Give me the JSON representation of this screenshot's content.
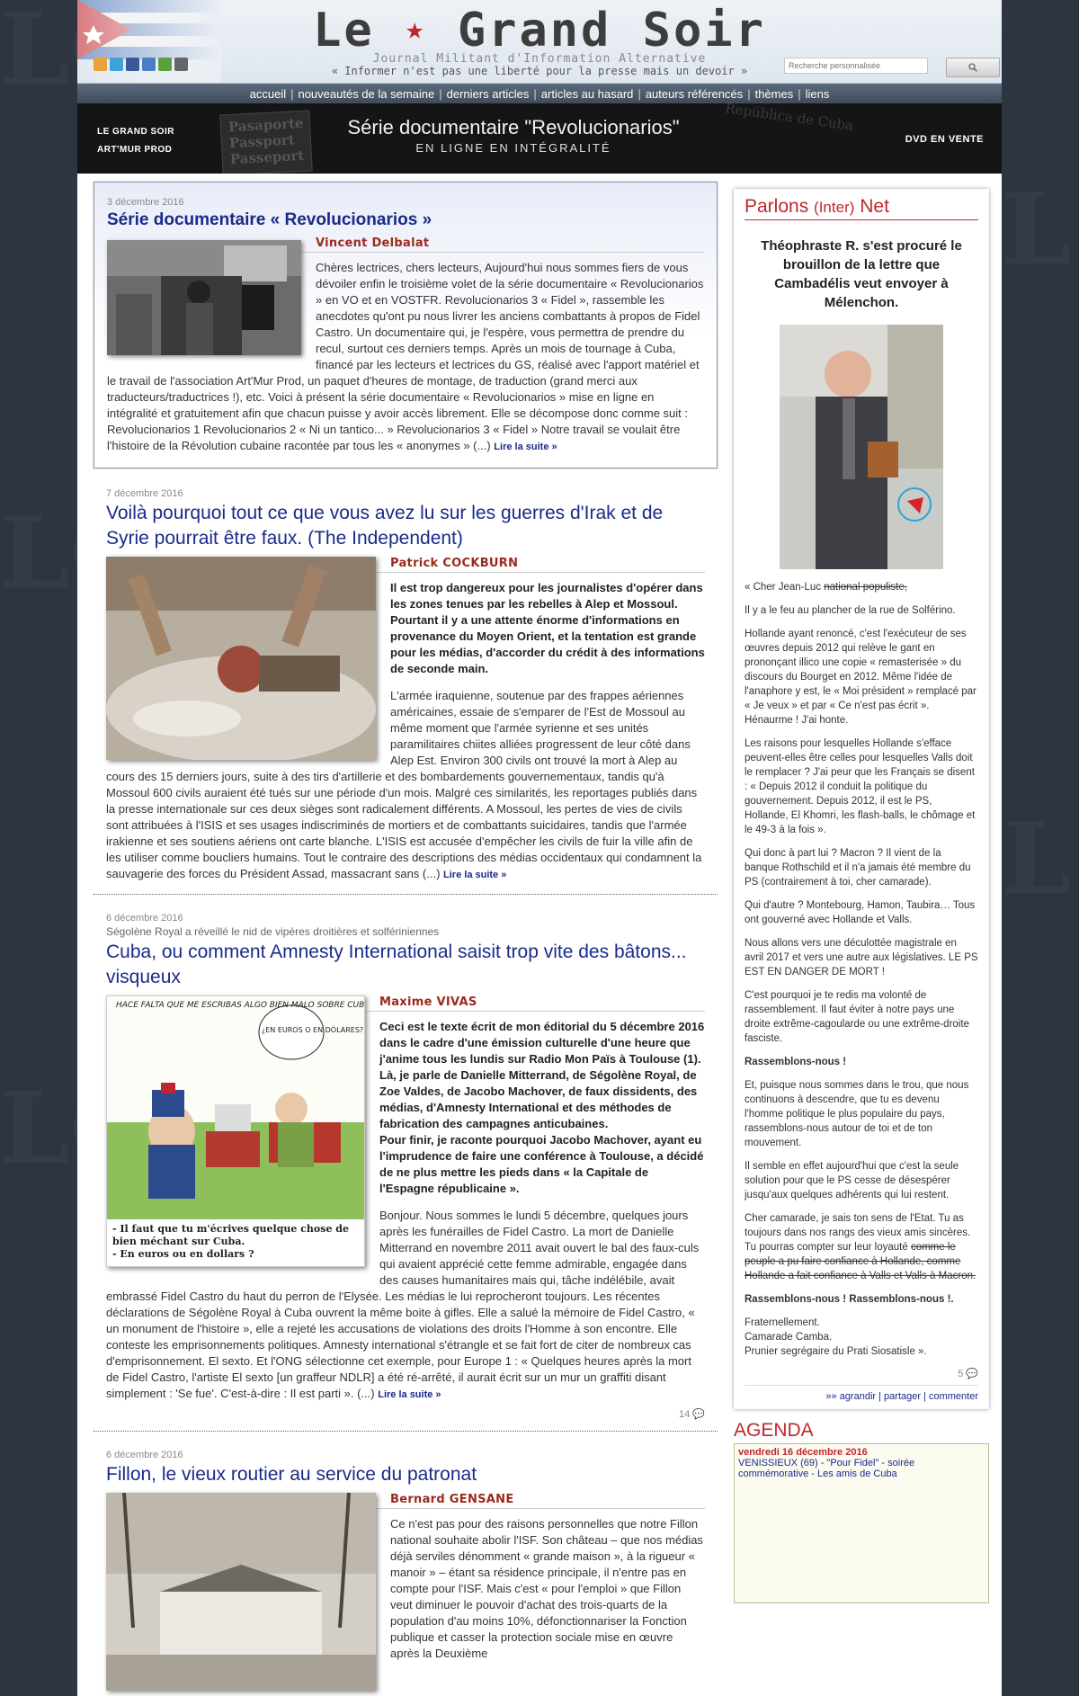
{
  "header": {
    "logo_left": "Le",
    "logo_right": "Grand Soir",
    "tagline": "Journal Militant d'Information Alternative",
    "motto": "« Informer n'est pas une liberté pour la presse mais un devoir »",
    "search_placeholder": "Recherche personnalisée"
  },
  "nav": {
    "items": [
      "accueil",
      "nouveautés de la semaine",
      "derniers articles",
      "articles au hasard",
      "auteurs référencés",
      "thèmes",
      "liens"
    ]
  },
  "banner": {
    "left_line1": "LE GRAND SOIR",
    "left_line2": "ART'MUR PROD",
    "passport_words": "Pasaporte Passport Passeport",
    "title": "Série documentaire \"Revolucionarios\"",
    "subtitle": "EN LIGNE EN INTÉGRALITÉ",
    "stamp": "República de Cuba",
    "right": "DVD EN VENTE"
  },
  "articles": [
    {
      "date": "3 décembre 2016",
      "kicker": "",
      "title": "Série documentaire « Revolucionarios »",
      "author": "Vincent Delbalat",
      "lead": "",
      "body": "Chères lectrices, chers lecteurs, Aujourd'hui nous sommes fiers de vous dévoiler enfin le troisième volet de la série documentaire « Revolucionarios » en VO et en VOSTFR. Revolucionarios 3 « Fidel », rassemble les anecdotes qu'ont pu nous livrer les anciens combattants à propos de Fidel Castro. Un documentaire qui, je l'espère, vous permettra de prendre du recul, surtout ces derniers temps. Après un mois de tournage à Cuba, financé par les lecteurs et lectrices du GS, réalisé avec l'apport matériel et le travail de l'association Art'Mur Prod, un paquet d'heures de montage, de traduction (grand merci aux traducteurs/traductrices !), etc. Voici à présent la série documentaire « Revolucionarios » mise en ligne en intégralité et gratuitement afin que chacun puisse y avoir accès librement. Elle se décompose donc comme suit : Revolucionarios 1 Revolucionarios 2 « Ni un tantico... » Revolucionarios 3 « Fidel » Notre travail se voulait être l'histoire de la Révolution cubaine racontée par tous les « anonymes » (...)",
      "readmore": "Lire la suite »",
      "comments": ""
    },
    {
      "date": "7 décembre 2016",
      "kicker": "",
      "title": "Voilà pourquoi tout ce que vous avez lu sur les guerres d'Irak et de Syrie pourrait être faux. (The Independent)",
      "author": "Patrick COCKBURN",
      "lead": "Il est trop dangereux pour les journalistes d'opérer dans les zones tenues par les rebelles à Alep et Mossoul. Pourtant il y a une attente énorme d'informations en provenance du Moyen Orient, et la tentation est grande pour les médias, d'accorder du crédit à des informations de seconde main.",
      "body": "L'armée iraquienne, soutenue par des frappes aériennes américaines, essaie de s'emparer de l'Est de Mossoul au même moment que l'armée syrienne et ses unités paramilitaires chiites alliées progressent de leur côté dans Alep Est. Environ 300 civils ont trouvé la mort à Alep au cours des 15 derniers jours, suite à des tirs d'artillerie et des bombardements gouvernementaux, tandis qu'à Mossoul 600 civils auraient été tués sur une période d'un mois. Malgré ces similarités, les reportages publiés dans la presse internationale sur ces deux sièges sont radicalement différents. A Mossoul, les pertes de vies de civils sont attribuées à l'ISIS et ses usages indiscriminés de mortiers et de combattants suicidaires, tandis que l'armée irakienne et ses soutiens aériens ont carte blanche. L'ISIS est accusée d'empêcher les civils de fuir la ville afin de les utiliser comme boucliers humains. Tout le contraire des descriptions des médias occidentaux qui condamnent la sauvagerie des forces du Président Assad, massacrant sans (...)",
      "readmore": "Lire la suite »",
      "comments": ""
    },
    {
      "date": "6 décembre 2016",
      "kicker": "Ségolène Royal a réveillé le nid de vipères droitières et solfériniennes",
      "title": "Cuba, ou comment Amnesty International saisit trop vite des bâtons... visqueux",
      "author": "Maxime VIVAS",
      "lead_paragraphs": [
        "Ceci est le texte écrit de mon éditorial du 5 décembre 2016 dans le cadre d'une émission culturelle d'une heure que j'anime tous les lundis sur Radio Mon Païs à Toulouse (1).",
        "Là, je parle de Danielle Mitterrand, de Ségolène Royal, de Zoe Valdes, de Jacobo Machover, de faux dissidents, des médias, d'Amnesty International et des méthodes de fabrication des campagnes anticubaines.",
        "Pour finir, je raconte pourquoi Jacobo Machover, ayant eu l'imprudence de faire une conférence à Toulouse, a décidé de ne plus mettre les pieds dans « la Capitale de l'Espagne républicaine »."
      ],
      "body": "Bonjour. Nous sommes le lundi 5 décembre, quelques jours après les funérailles de Fidel Castro. La mort de Danielle Mitterrand en novembre 2011 avait ouvert le bal des faux-culs qui avaient apprécié cette femme admirable, engagée dans des causes humanitaires mais qui, tâche indélébile, avait embrassé Fidel Castro du haut du perron de l'Elysée. Les médias le lui reprocheront toujours. Les récentes déclarations de Ségolène Royal à Cuba ouvrent la même boite à gifles. Elle a salué la mémoire de Fidel Castro, « un monument de l'histoire », elle a rejeté les accusations de violations des droits l'Homme à son encontre. Elle conteste les emprisonnements politiques. Amnesty international s'étrangle et se fait fort de citer de nombreux cas d'emprisonnement. El sexto. Et l'ONG sélectionne cet exemple, pour Europe 1 : « Quelques heures après la mort de Fidel Castro, l'artiste El sexto [un graffeur NDLR] a été ré-arrêté, il aurait écrit sur un mur un graffiti disant simplement : 'Se fue'. C'est-à-dire : Il est parti ». (...)",
      "readmore": "Lire la suite »",
      "comments": "14",
      "cartoon_top": "HACE FALTA QUE ME ESCRIBAS ALGO BIEN MALO SOBRE CUBA...",
      "cartoon_bubble": "¿EN EUROS O EN DÓLARES?",
      "cartoon_caption1": "- Il faut que tu m'écrives quelque chose de bien méchant sur Cuba.",
      "cartoon_caption2": "- En euros ou en dollars ?"
    },
    {
      "date": "6 décembre 2016",
      "kicker": "",
      "title": "Fillon, le vieux routier au service du patronat",
      "author": "Bernard GENSANE",
      "lead": "",
      "body": "Ce n'est pas pour des raisons personnelles que notre Fillon national souhaite abolir l'ISF. Son château – que nos médias déjà serviles dénomment « grande maison », à la rigueur « manoir » – étant sa résidence principale, il n'entre pas en compte pour l'ISF. Mais c'est « pour l'emploi » que Fillon veut diminuer le pouvoir d'achat des trois-quarts de la population d'au moins 10%, défonctionnariser la Fonction publique et casser la protection sociale mise en œuvre après la Deuxième",
      "readmore": "",
      "comments": ""
    }
  ],
  "sidebar": {
    "parlons_title": "Parlons",
    "parlons_inter": "(Inter)",
    "parlons_net": "Net",
    "headline": "Théophraste R. s'est procuré le brouillon de la lettre que Cambadélis veut envoyer à Mélenchon.",
    "p1_start": "« Cher Jean-Luc ",
    "p1_strike": "national populiste,",
    "p2": "Il y a le feu au plancher de la rue de Solférino.",
    "p3": "Hollande ayant renoncé, c'est l'exécuteur de ses œuvres depuis 2012 qui relève le gant en prononçant illico une copie « remasterisée » du discours du Bourget en 2012. Même l'idée de l'anaphore y est, le « Moi président » remplacé par « Je veux » et par « Ce n'est pas écrit ». Hénaurme ! J'ai honte.",
    "p4": "Les raisons pour lesquelles Hollande s'efface peuvent-elles être celles pour lesquelles Valls doit le remplacer ? J'ai peur que les Français se disent : « Depuis 2012 il conduit la politique du gouvernement. Depuis 2012, il est le PS, Hollande, El Khomri, les flash-balls, le chômage et le 49-3 à la fois ».",
    "p5": "Qui donc à part lui ? Macron ? Il vient de la banque Rothschild et il n'a jamais été membre du PS (contrairement à toi, cher camarade).",
    "p6": "Qui d'autre ? Montebourg, Hamon, Taubira… Tous ont gouverné avec Hollande et Valls.",
    "p7": "Nous allons vers une déculottée magistrale en avril 2017 et vers une autre aux législatives. LE PS EST EN DANGER DE MORT !",
    "p8": "C'est pourquoi je te redis ma volonté de rassemblement. Il faut éviter à notre pays une droite extrême-cagoularde ou une extrême-droite fasciste.",
    "p9": "Rassemblons-nous !",
    "p10": "Et, puisque nous sommes dans le trou, que nous continuons à descendre, que tu es devenu l'homme politique le plus populaire du pays, rassemblons-nous autour de toi et de ton mouvement.",
    "p11": "Il semble en effet aujourd'hui que c'est la seule solution pour que le PS cesse de désespérer jusqu'aux quelques adhérents qui lui restent.",
    "p12_start": "Cher camarade, je sais ton sens de l'Etat. Tu as toujours dans nos rangs des vieux amis sincères. Tu pourras compter sur leur loyauté ",
    "p12_strike": "comme le peuple a pu faire confiance à Hollande, comme Hollande a fait confiance à Valls et Valls à Macron.",
    "p13": "Rassemblons-nous ! Rassemblons-nous !.",
    "p14_1": "Fraternellement.",
    "p14_2": "Camarade Camba.",
    "p14_3": "Prunier segrégaire du Prati Siosatisle ».",
    "comments": "5",
    "links": "»» agrandir | partager | commenter",
    "agenda_title": "AGENDA",
    "agenda_date": "vendredi 16 décembre 2016",
    "agenda_event": "VENISSIEUX (69) - \"Pour Fidel\" - soirée commémorative - Les amis de Cuba"
  },
  "colors": {
    "title_blue": "#1a2a8a",
    "author_red": "#9b2a1e",
    "accent_red": "#c0272d",
    "nav_bg": "#4d5a69"
  }
}
